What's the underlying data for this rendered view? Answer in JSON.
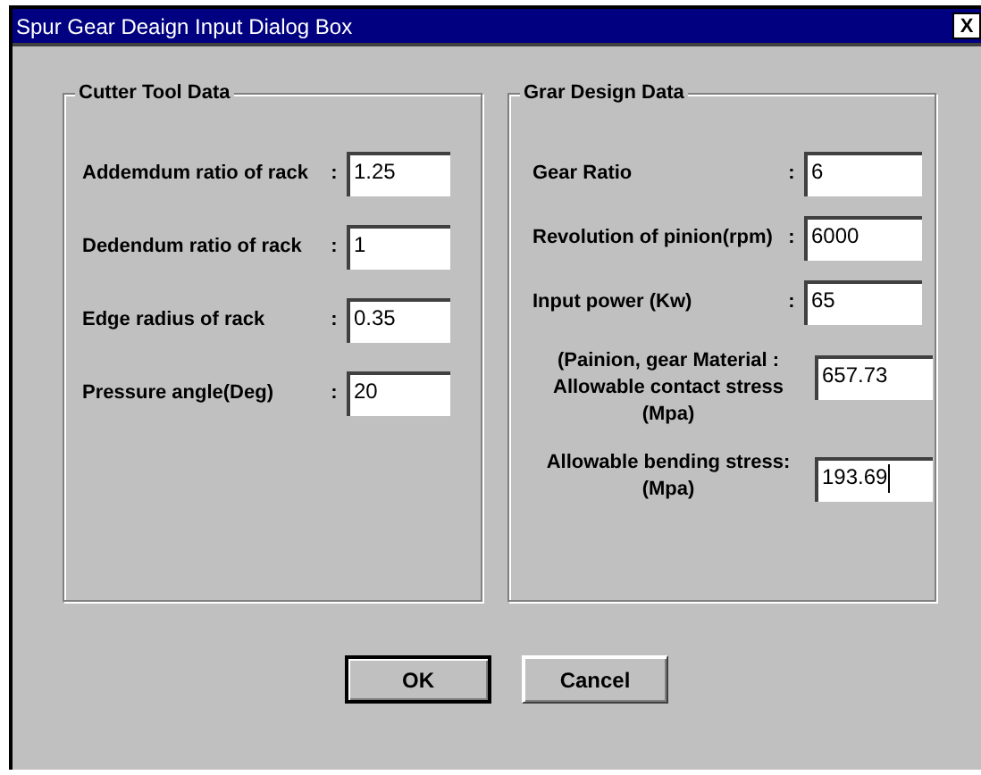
{
  "window": {
    "title": "Spur Gear Deaign Input Dialog Box",
    "close": "X"
  },
  "groups": [
    {
      "title": "Cutter Tool Data",
      "rows": [
        {
          "label": [
            "Addemdum ratio of rack"
          ],
          "colon": ":",
          "value": "1.25",
          "focused": false
        },
        {
          "label": [
            "Dedendum ratio of rack"
          ],
          "colon": ":",
          "value": "1",
          "focused": false
        },
        {
          "label": [
            "Edge radius of rack"
          ],
          "colon": ":",
          "value": "0.35",
          "focused": false
        },
        {
          "label": [
            "Pressure angle(Deg)"
          ],
          "colon": ":",
          "value": "20",
          "focused": false
        }
      ]
    },
    {
      "title": "Grar Design Data",
      "rows": [
        {
          "label": [
            "Gear Ratio"
          ],
          "colon": ":",
          "value": "6",
          "focused": false
        },
        {
          "label": [
            "Revolution of pinion(rpm)"
          ],
          "colon": ":",
          "value": "6000",
          "focused": false
        },
        {
          "label": [
            "Input power (Kw)"
          ],
          "colon": ":",
          "value": "65",
          "focused": false
        },
        {
          "label": [
            "(Painion, gear   Material :",
            "Allowable contact stress",
            "(Mpa)"
          ],
          "value": "657.73",
          "focused": false
        },
        {
          "label": [
            "Allowable bending stress:",
            "(Mpa)"
          ],
          "value": "193.69",
          "focused": true
        }
      ]
    }
  ],
  "buttons": [
    {
      "label": "OK",
      "default": true
    },
    {
      "label": "Cancel",
      "default": false
    }
  ]
}
